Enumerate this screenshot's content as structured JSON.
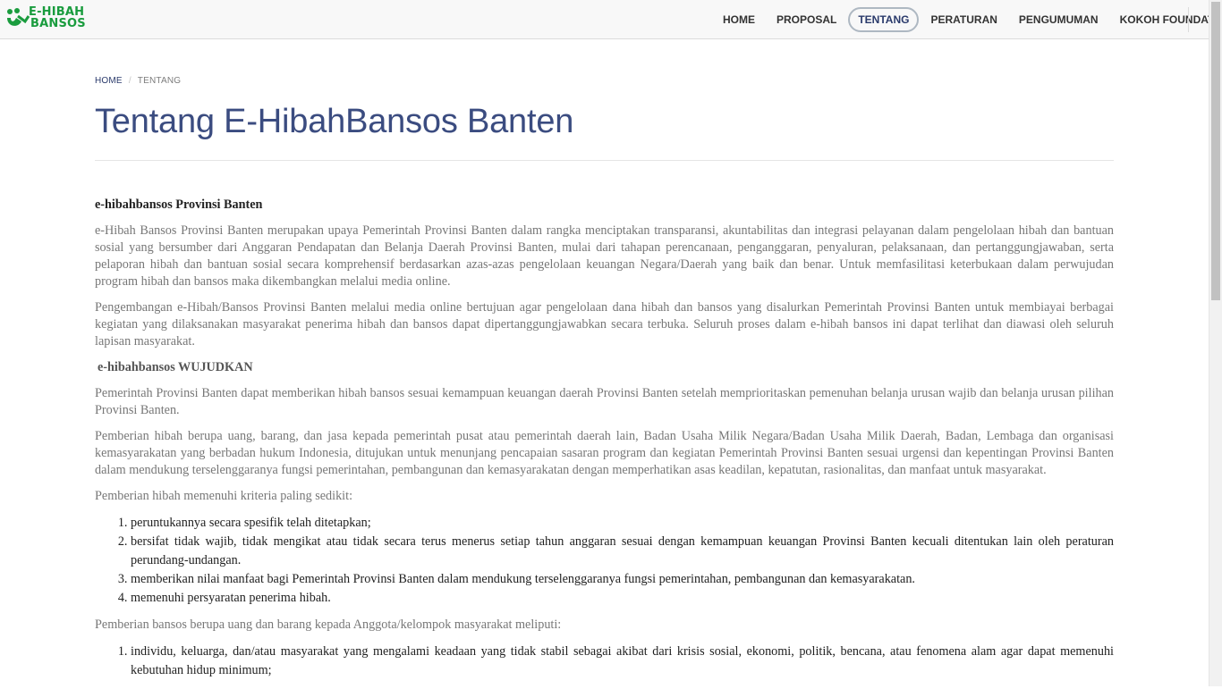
{
  "brand": {
    "line1": "E-HIBAH",
    "line2": "BANSOS",
    "color": "#1a9c3e"
  },
  "nav": {
    "items": [
      {
        "label": "HOME"
      },
      {
        "label": "PROPOSAL"
      },
      {
        "label": "TENTANG",
        "active": true
      },
      {
        "label": "PERATURAN"
      },
      {
        "label": "PENGUMUMAN"
      },
      {
        "label": "KOKOH FOUNDATION"
      }
    ]
  },
  "breadcrumb": {
    "home": "HOME",
    "current": "TENTANG"
  },
  "page": {
    "title": "Tentang E-HibahBansos Banten"
  },
  "article": {
    "heading1": "e-hibahbansos Provinsi Banten",
    "p1": "e-Hibah Bansos Provinsi Banten merupakan upaya Pemerintah Provinsi Banten dalam rangka menciptakan transparansi, akuntabilitas dan integrasi pelayanan dalam pengelolaan hibah dan bantuan sosial yang bersumber dari Anggaran Pendapatan dan Belanja Daerah Provinsi Banten, mulai dari tahapan perencanaan, penganggaran, penyaluran, pelaksanaan, dan pertanggungjawaban, serta pelaporan hibah dan bantuan sosial secara komprehensif berdasarkan azas-azas pengelolaan keuangan Negara/Daerah yang baik dan benar. Untuk memfasilitasi keterbukaan dalam perwujudan program hibah dan bansos maka dikembangkan melalui media online.",
    "p2": "Pengembangan e-Hibah/Bansos Provinsi Banten melalui media online bertujuan agar pengelolaan dana hibah dan bansos yang disalurkan Pemerintah Provinsi Banten untuk membiayai berbagai kegiatan yang dilaksanakan masyarakat penerima hibah dan bansos dapat dipertanggungjawabkan secara terbuka. Seluruh proses dalam e-hibah bansos ini dapat terlihat dan diawasi oleh seluruh lapisan masyarakat.",
    "heading2": "e-hibahbansos WUJUDKAN",
    "p3": "Pemerintah Provinsi Banten dapat memberikan hibah bansos sesuai kemampuan keuangan daerah Provinsi Banten setelah memprioritaskan pemenuhan belanja urusan wajib dan belanja urusan pilihan Provinsi Banten.",
    "p4": "Pemberian hibah berupa uang, barang, dan jasa kepada pemerintah pusat atau pemerintah daerah lain, Badan Usaha Milik Negara/Badan Usaha Milik Daerah, Badan, Lembaga dan organisasi kemasyarakatan yang berbadan hukum Indonesia, ditujukan untuk menunjang pencapaian sasaran program dan kegiatan Pemerintah Provinsi Banten sesuai urgensi dan kepentingan Provinsi Banten dalam mendukung terselenggaranya fungsi pemerintahan, pembangunan dan kemasyarakatan dengan memperhatikan asas keadilan, kepatutan, rasionalitas, dan manfaat untuk masyarakat.",
    "p5": "Pemberian hibah memenuhi kriteria paling sedikit:",
    "list1": [
      "peruntukannya secara spesifik telah ditetapkan;",
      "bersifat tidak wajib, tidak mengikat atau tidak secara terus menerus setiap tahun anggaran sesuai dengan kemampuan keuangan Provinsi Banten  kecuali ditentukan lain oleh peraturan perundang-undangan.",
      "memberikan nilai manfaat bagi Pemerintah Provinsi Banten dalam mendukung terselenggaranya fungsi pemerintahan, pembangunan dan kemasyarakatan.",
      "memenuhi persyaratan penerima hibah."
    ],
    "p6": "Pemberian bansos berupa uang dan barang kepada Anggota/kelompok masyarakat meliputi:",
    "list2": [
      "individu, keluarga, dan/atau masyarakat yang mengalami keadaan yang tidak stabil sebagai akibat dari krisis sosial, ekonomi, politik, bencana, atau fenomena alam agar dapat memenuhi kebutuhan hidup minimum;"
    ]
  }
}
